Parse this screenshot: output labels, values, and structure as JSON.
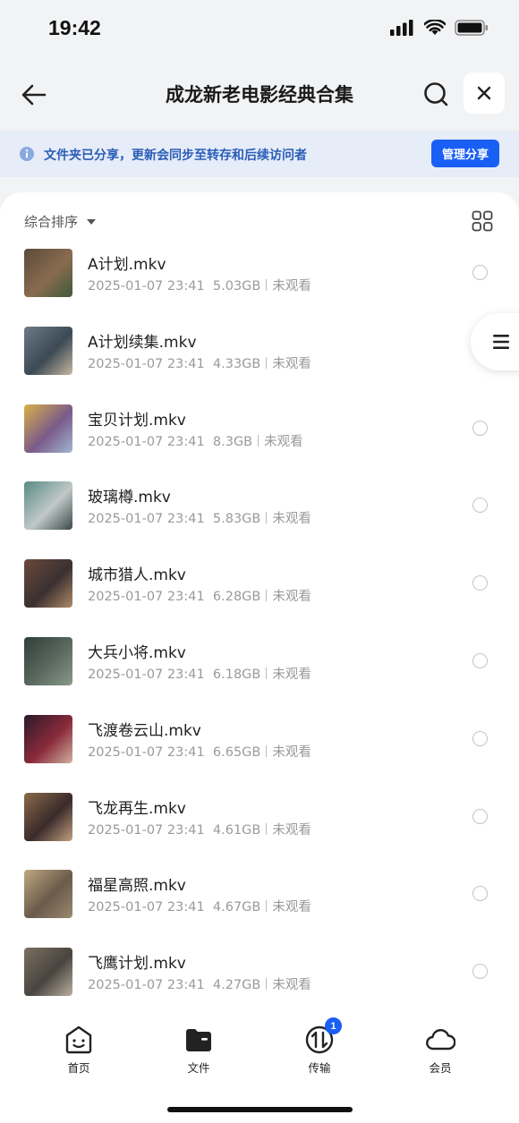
{
  "status_bar": {
    "time": "19:42"
  },
  "header": {
    "title": "成龙新老电影经典合集"
  },
  "share_banner": {
    "text": "文件夹已分享，更新会同步至转存和后续访问者",
    "button_label": "管理分享"
  },
  "sort": {
    "label": "综合排序"
  },
  "files": [
    {
      "name": "A计划.mkv",
      "date": "2025-01-07 23:41",
      "size": "5.03GB",
      "status": "未观看"
    },
    {
      "name": "A计划续集.mkv",
      "date": "2025-01-07 23:41",
      "size": "4.33GB",
      "status": "未观看"
    },
    {
      "name": "宝贝计划.mkv",
      "date": "2025-01-07 23:41",
      "size": "8.3GB",
      "status": "未观看"
    },
    {
      "name": "玻璃樽.mkv",
      "date": "2025-01-07 23:41",
      "size": "5.83GB",
      "status": "未观看"
    },
    {
      "name": "城市猎人.mkv",
      "date": "2025-01-07 23:41",
      "size": "6.28GB",
      "status": "未观看"
    },
    {
      "name": "大兵小将.mkv",
      "date": "2025-01-07 23:41",
      "size": "6.18GB",
      "status": "未观看"
    },
    {
      "name": "飞渡卷云山.mkv",
      "date": "2025-01-07 23:41",
      "size": "6.65GB",
      "status": "未观看"
    },
    {
      "name": "飞龙再生.mkv",
      "date": "2025-01-07 23:41",
      "size": "4.61GB",
      "status": "未观看"
    },
    {
      "name": "福星高照.mkv",
      "date": "2025-01-07 23:41",
      "size": "4.67GB",
      "status": "未观看"
    },
    {
      "name": "飞鹰计划.mkv",
      "date": "2025-01-07 23:41",
      "size": "4.27GB",
      "status": "未观看"
    }
  ],
  "tab_bar": {
    "tabs": [
      {
        "label": "首页",
        "icon": "smile-face-icon"
      },
      {
        "label": "文件",
        "icon": "folder-icon"
      },
      {
        "label": "传输",
        "icon": "transfer-icon",
        "badge": "1"
      },
      {
        "label": "会员",
        "icon": "cloud-icon"
      }
    ]
  },
  "colors": {
    "accent": "#1a5ff5",
    "banner_bg": "#e6ecf8",
    "banner_text": "#2a5db8",
    "top_bg": "#f2f3f5"
  }
}
